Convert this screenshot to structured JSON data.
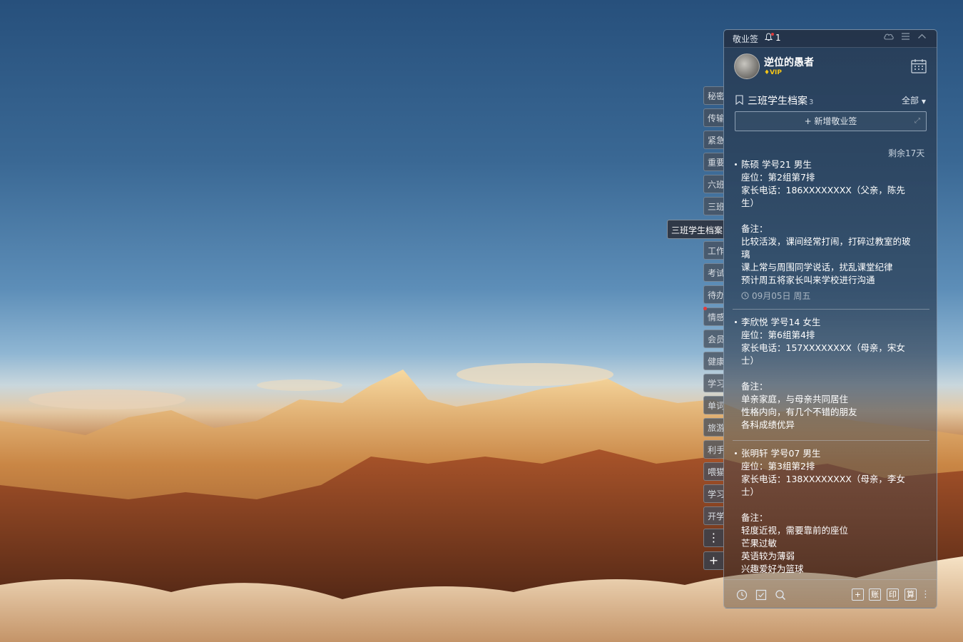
{
  "app": {
    "title": "敬业签",
    "notification_count": "1"
  },
  "user": {
    "name": "逆位的愚者",
    "badge": "VIP"
  },
  "side_tabs": [
    "秘密",
    "传输",
    "紧急",
    "重要",
    "六班",
    "三班",
    "三班学生档案",
    "工作",
    "考试",
    "待办",
    "情感",
    "会员",
    "健康",
    "学习",
    "单词",
    "旅游",
    "利手",
    "喂猫",
    "学习",
    "开学"
  ],
  "active_tab": "三班学生档案",
  "side_buttons": {
    "more": "⋮",
    "add": "+"
  },
  "list": {
    "title": "三班学生档案",
    "count": "3",
    "filter": "全部",
    "new_note": "+ 新增敬业签"
  },
  "remaining": "剩余17天",
  "notes": [
    {
      "lines": [
        "陈硕 学号21 男生",
        "座位：第2组第7排",
        "家长电话：186XXXXXXXX（父亲，陈先",
        "生）",
        "",
        "备注：",
        "比较活泼，课间经常打闹，打碎过教室的玻",
        "璃",
        "课上常与周围同学说话，扰乱课堂纪律",
        "预计周五将家长叫来学校进行沟通"
      ],
      "date": "09月05日 周五"
    },
    {
      "lines": [
        "李欣悦 学号14 女生",
        "座位：第6组第4排",
        "家长电话：157XXXXXXXX（母亲，宋女",
        "士）",
        "",
        "备注：",
        "单亲家庭，与母亲共同居住",
        "性格内向，有几个不错的朋友",
        "各科成绩优异"
      ],
      "date": ""
    },
    {
      "lines": [
        "张明轩 学号07 男生",
        "座位：第3组第2排",
        "家长电话：138XXXXXXXX（母亲，李女",
        "士）",
        "",
        "备注：",
        "轻度近视，需要靠前的座位",
        "芒果过敏",
        "英语较为薄弱",
        "兴趣爱好为篮球"
      ],
      "date": ""
    }
  ],
  "bottom_boxes": [
    "+",
    "账",
    "印",
    "算"
  ],
  "icons": [
    "bell-icon",
    "cloud-icon",
    "menu-icon",
    "collapse-icon",
    "calendar-icon",
    "bookmark-icon",
    "clock-icon",
    "checkbox-icon",
    "search-icon",
    "more-icon"
  ]
}
